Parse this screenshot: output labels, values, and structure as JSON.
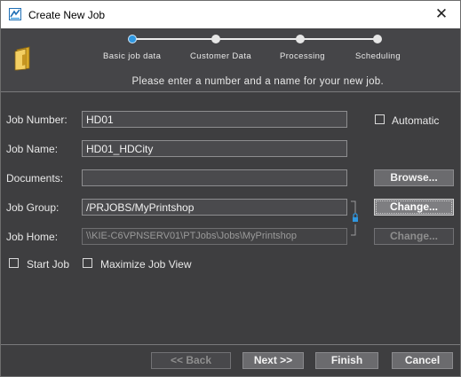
{
  "window": {
    "title": "Create New Job",
    "close_symbol": "✕"
  },
  "wizard": {
    "steps": [
      {
        "label": "Basic job data",
        "active": true
      },
      {
        "label": "Customer Data",
        "active": false
      },
      {
        "label": "Processing",
        "active": false
      },
      {
        "label": "Scheduling",
        "active": false
      }
    ],
    "instruction": "Please enter a number and a name for your new job.",
    "accent_color": "#2f97e0"
  },
  "form": {
    "job_number": {
      "label": "Job Number:",
      "value": "HD01"
    },
    "automatic": {
      "label": "Automatic",
      "checked": false
    },
    "job_name": {
      "label": "Job Name:",
      "value": "HD01_HDCity"
    },
    "documents": {
      "label": "Documents:",
      "value": ""
    },
    "browse_label": "Browse...",
    "job_group": {
      "label": "Job Group:",
      "value": "/PRJOBS/MyPrintshop"
    },
    "change_group_label": "Change...",
    "job_home": {
      "label": "Job Home:",
      "value": "\\\\KIE-C6VPNSERV01\\PTJobs\\Jobs\\MyPrintshop"
    },
    "change_home_label": "Change...",
    "start_job": {
      "label": "Start Job",
      "checked": false
    },
    "maximize_job_view": {
      "label": "Maximize Job View",
      "checked": false
    }
  },
  "footer": {
    "back_label": "<< Back",
    "next_label": "Next >>",
    "finish_label": "Finish",
    "cancel_label": "Cancel"
  },
  "icons": [
    "app-icon",
    "close-icon",
    "folder-icon",
    "lock-icon"
  ]
}
